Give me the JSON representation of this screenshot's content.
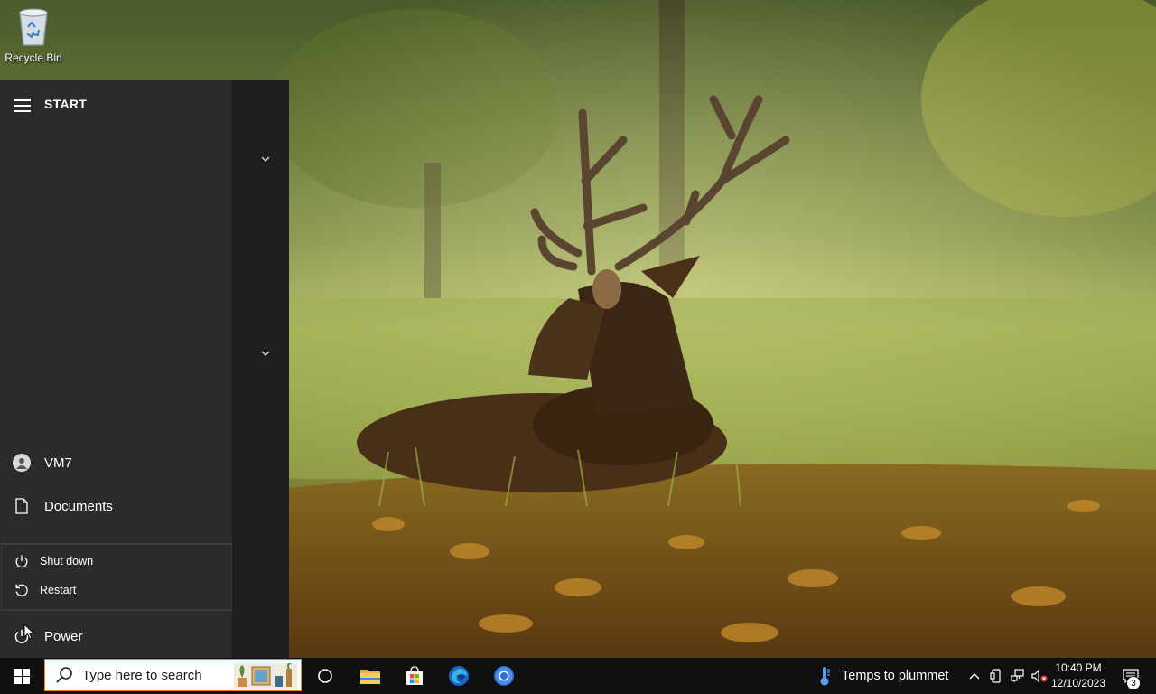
{
  "desktop": {
    "icons": [
      {
        "label": "Recycle Bin",
        "icon": "recycle-bin-icon"
      }
    ]
  },
  "start_menu": {
    "title": "START",
    "user_label": "VM7",
    "documents_label": "Documents",
    "power_label": "Power",
    "power_options": [
      {
        "label": "Shut down",
        "icon": "power-icon"
      },
      {
        "label": "Restart",
        "icon": "restart-icon"
      }
    ]
  },
  "taskbar": {
    "search_placeholder": "Type here to search",
    "pinned": [
      {
        "name": "task-view",
        "icon": "task-view-icon"
      },
      {
        "name": "file-explorer",
        "icon": "folder-icon"
      },
      {
        "name": "microsoft-store",
        "icon": "store-icon"
      },
      {
        "name": "edge",
        "icon": "edge-icon"
      },
      {
        "name": "chrome",
        "icon": "chrome-icon"
      }
    ],
    "weather_text": "Temps to plummet",
    "clock": {
      "time": "10:40 PM",
      "date": "12/10/2023"
    },
    "notification_count": "3"
  },
  "colors": {
    "start_bg": "#2b2b2b",
    "taskbar_bg": "#101010",
    "search_border": "#e08a1e"
  }
}
